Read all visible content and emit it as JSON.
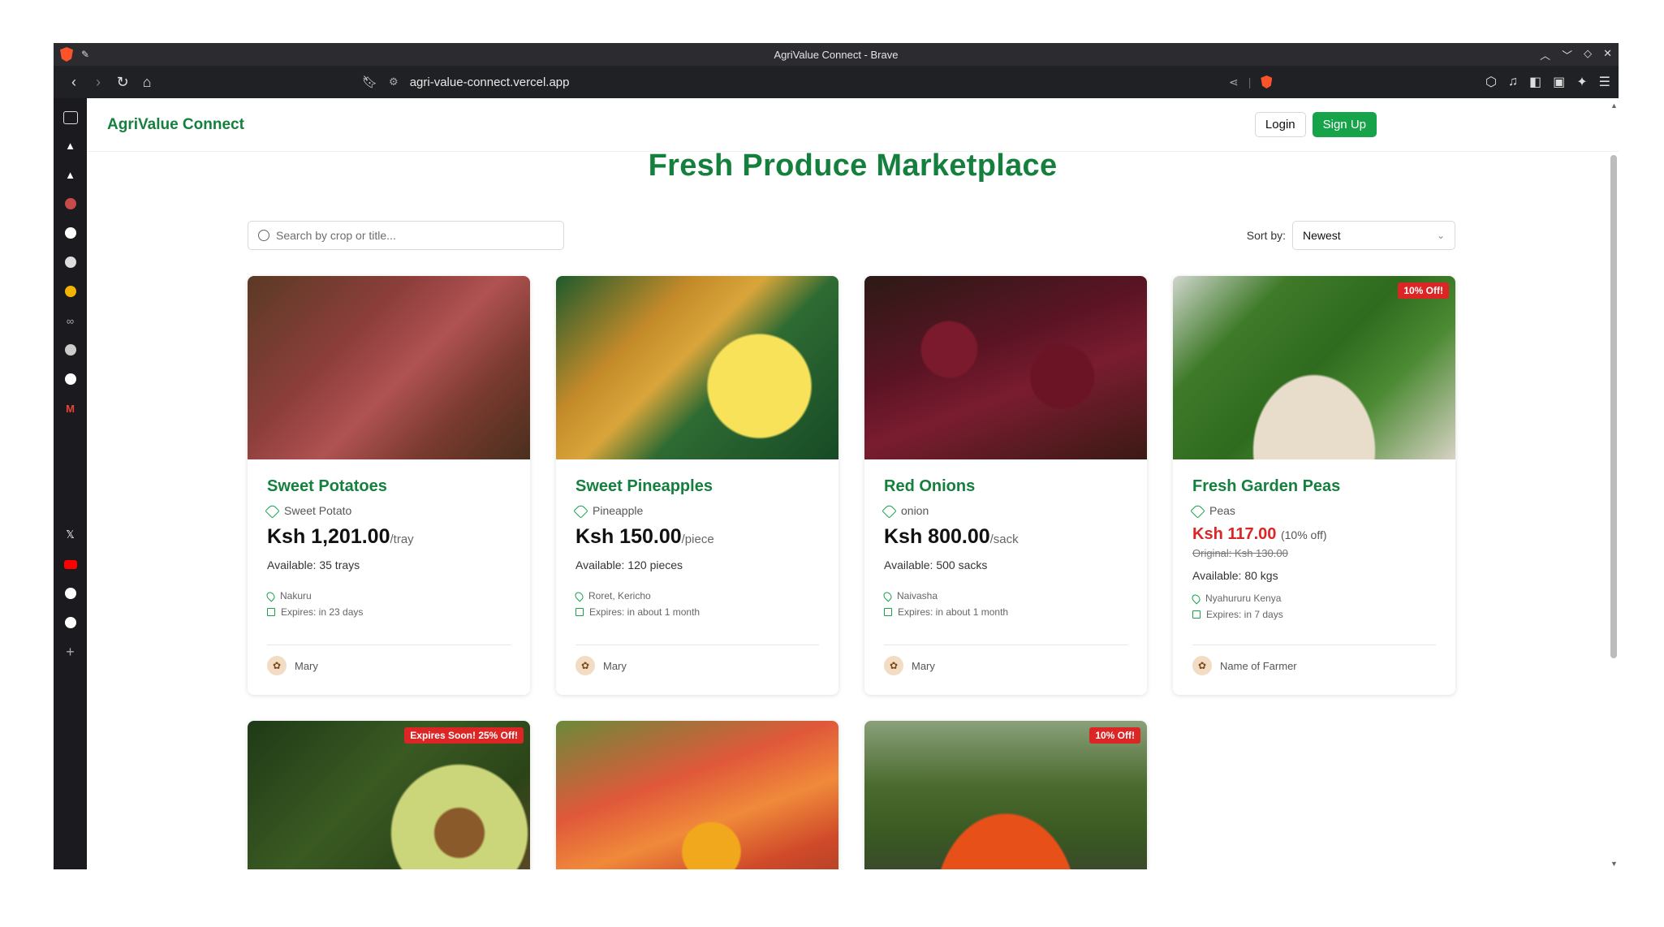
{
  "browser": {
    "window_title": "AgriValue Connect - Brave",
    "url": "agri-value-connect.vercel.app"
  },
  "site": {
    "brand": "AgriValue Connect",
    "login_label": "Login",
    "signup_label": "Sign Up",
    "heading": "Fresh Produce Marketplace",
    "search_placeholder": "Search by crop or title...",
    "sort_label": "Sort by:",
    "sort_value": "Newest"
  },
  "colors": {
    "brand_green": "#15803d",
    "button_green": "#16a34a",
    "badge_red": "#dc2626"
  },
  "products": [
    {
      "title": "Sweet Potatoes",
      "crop": "Sweet Potato",
      "price": "Ksh 1,201.00",
      "unit": "/tray",
      "available": "Available: 35 trays",
      "location": "Nakuru",
      "expires": "Expires: in 23 days",
      "farmer": "Mary",
      "badge": ""
    },
    {
      "title": "Sweet Pineapples",
      "crop": "Pineapple",
      "price": "Ksh 150.00",
      "unit": "/piece",
      "available": "Available: 120 pieces",
      "location": "Roret, Kericho",
      "expires": "Expires: in about 1 month",
      "farmer": "Mary",
      "badge": ""
    },
    {
      "title": "Red Onions",
      "crop": "onion",
      "price": "Ksh 800.00",
      "unit": "/sack",
      "available": "Available: 500 sacks",
      "location": "Naivasha",
      "expires": "Expires: in about 1 month",
      "farmer": "Mary",
      "badge": ""
    },
    {
      "title": "Fresh Garden Peas",
      "crop": "Peas",
      "price": "Ksh 117.00",
      "discount_note": "(10% off)",
      "original": "Original: Ksh 130.00",
      "available": "Available: 80 kgs",
      "location": "Nyahururu Kenya",
      "expires": "Expires: in 7 days",
      "farmer": "Name of Farmer",
      "badge": "10% Off!"
    }
  ],
  "second_row_badges": [
    "Expires Soon! 25% Off!",
    "",
    "10% Off!"
  ]
}
